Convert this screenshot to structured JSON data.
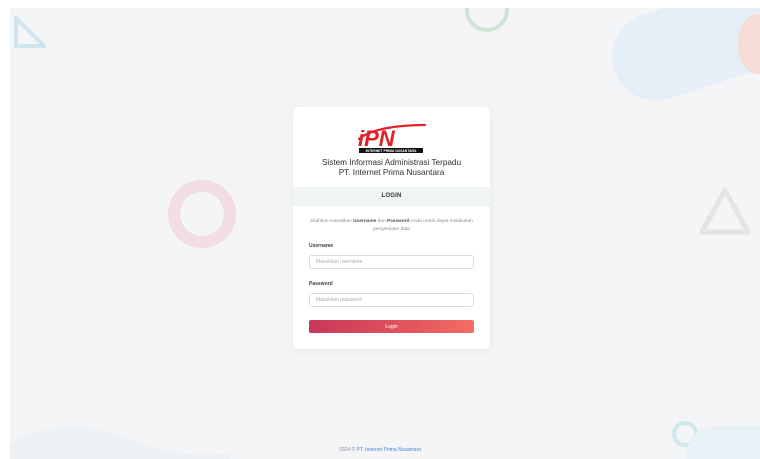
{
  "brand": {
    "logo_text": "iPN",
    "logo_tagline": "INTERNET PRIMA NUSANTARA",
    "colors": {
      "logo_red": "#e32027",
      "logo_dark": "#111111",
      "button_start": "#c8385a",
      "button_end": "#f26d63",
      "link": "#4a7fd4"
    }
  },
  "card": {
    "title_line1": "Sistem Informasi Administrasi Terpadu",
    "title_line2": "PT. Internet Prima Nusantara",
    "section_header": "LOGIN",
    "intro": {
      "prefix": "Silahkan masukkan ",
      "username_word": "Username",
      "middle": " dan ",
      "password_word": "Password",
      "suffix": " Anda untuk dapat melakukan pengelolaan data"
    },
    "username_label": "Username",
    "username_placeholder": "Masukkan username",
    "password_label": "Password",
    "password_placeholder": "Masukkan password",
    "login_button": "Login"
  },
  "footer": {
    "prefix": "2024 © ",
    "company": "PT. Internet Prima Nusantara"
  }
}
